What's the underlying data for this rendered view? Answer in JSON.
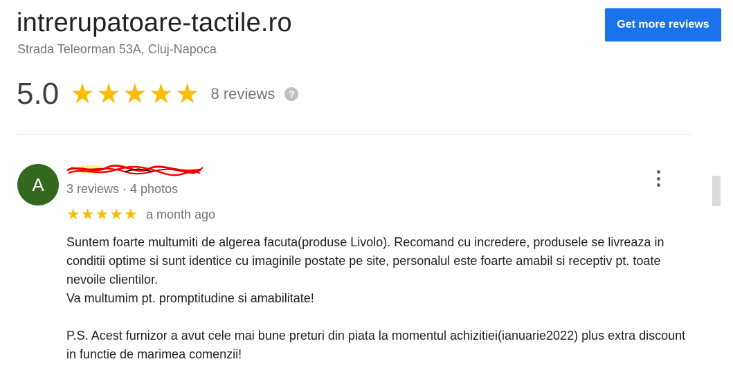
{
  "business": {
    "name": "intrerupatoare-tactile.ro",
    "address": "Strada Teleorman 53A, Cluj-Napoca",
    "rating": "5.0",
    "stars": 5,
    "review_count": "8 reviews",
    "help_icon": "?"
  },
  "actions": {
    "get_more_reviews": "Get more reviews"
  },
  "review": {
    "avatar_letter": "A",
    "avatar_color": "#33691e",
    "reviewer_meta": "3 reviews · 4 photos",
    "stars": 5,
    "time": "a month ago",
    "text": "Suntem foarte multumiti de algerea facuta(produse Livolo). Recomand cu incredere, produsele se livreaza in conditii optime si sunt identice cu imaginile postate pe site, personalul este foarte amabil si receptiv pt. toate nevoile clientilor.\nVa multumim pt. promptitudine si amabilitate!\n\nP.S. Acest furnizor a avut cele mai bune preturi din piata la momentul achizitiei(ianuarie2022) plus extra discount in functie de marimea comenzii!"
  },
  "icons": {
    "star": "star-icon",
    "more": "more-vert-icon",
    "help": "help-icon"
  },
  "colors": {
    "accent": "#1a73e8",
    "star": "#fbbc04",
    "redaction": "#ff0000"
  }
}
